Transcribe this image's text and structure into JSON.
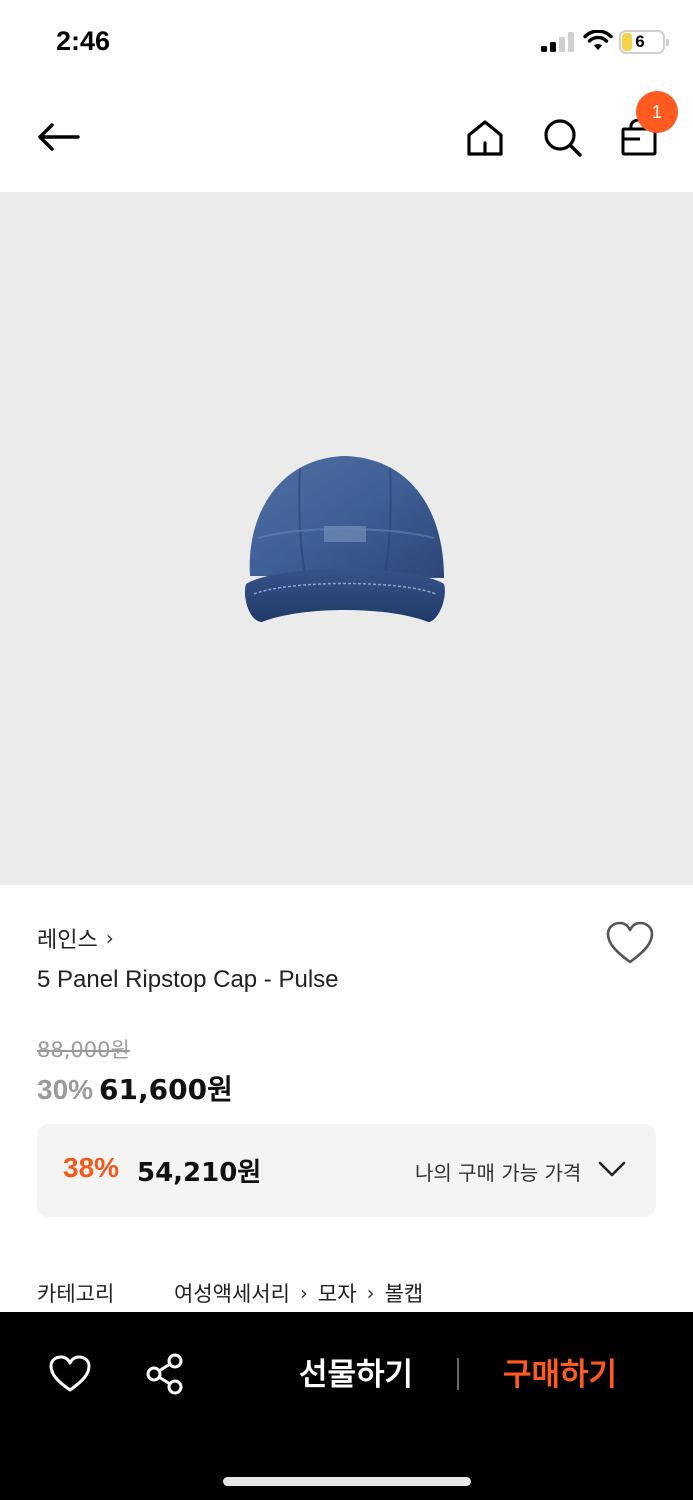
{
  "status_bar": {
    "time": "2:46",
    "battery_level": "6"
  },
  "nav": {
    "cart_count": "1",
    "accent_color": "#ff5a1f"
  },
  "product": {
    "brand": "레인스",
    "name": "5 Panel Ripstop Cap - Pulse",
    "original_price": "88,000원",
    "discount_rate": "30%",
    "sale_price": "61,600원",
    "image_icon": "navy-cap"
  },
  "my_price": {
    "discount_rate": "38%",
    "price": "54,210원",
    "label": "나의 구매 가능 가격"
  },
  "category": {
    "label": "카테고리",
    "path": [
      "여성액세서리",
      "모자",
      "볼캡"
    ]
  },
  "bottom_bar": {
    "gift_label": "선물하기",
    "buy_label": "구매하기"
  }
}
